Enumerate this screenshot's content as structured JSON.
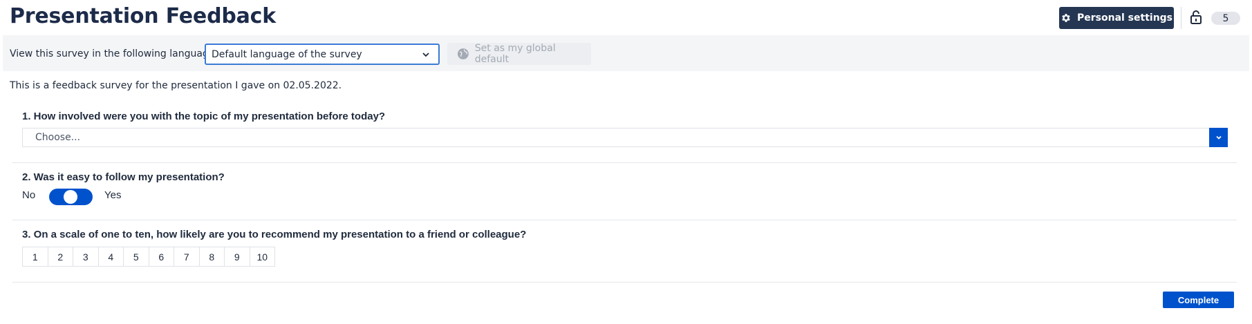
{
  "header": {
    "title": "Presentation Feedback",
    "personal_settings_label": "Personal settings",
    "count": "5"
  },
  "language_bar": {
    "label": "View this survey in the following language:",
    "selected_language": "Default language of the survey",
    "global_default_label": "Set as my global default"
  },
  "intro": "This is a feedback survey for the presentation I gave on 02.05.2022.",
  "questions": [
    {
      "label": "1. How involved were you with the topic of my presentation before today?",
      "type": "dropdown",
      "placeholder": "Choose..."
    },
    {
      "label": "2. Was it easy to follow my presentation?",
      "type": "toggle",
      "off_label": "No",
      "on_label": "Yes",
      "value": "unset"
    },
    {
      "label": "3. On a scale of one to ten, how likely are you to recommend my presentation to a friend or colleague?",
      "type": "scale",
      "options": [
        "1",
        "2",
        "3",
        "4",
        "5",
        "6",
        "7",
        "8",
        "9",
        "10"
      ]
    }
  ],
  "footer": {
    "complete_label": "Complete"
  },
  "colors": {
    "primary": "#0052cc",
    "header_button": "#243652",
    "title": "#1d2b4a"
  },
  "icons": {
    "settings": "gear-icon",
    "lock": "unlock-icon",
    "chevron": "chevron-down-icon",
    "globe": "globe-icon"
  }
}
